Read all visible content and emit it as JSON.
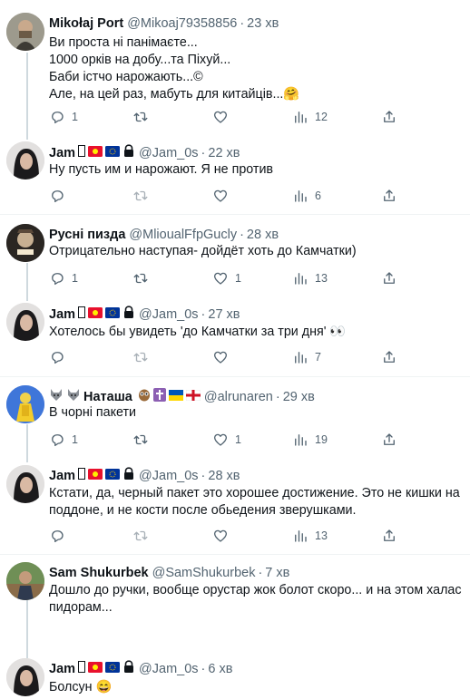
{
  "tweets": [
    {
      "name": "Mikołaj Port",
      "handle": "@Mikoaj79358856",
      "time": "23 хв",
      "lines": [
        "Ви проста ні панімаєте...",
        "1000 орків на добу...та Піхуй...",
        "Баби істчо нарожають...©",
        "Але, на цей раз, мабуть для китайців...🤗"
      ],
      "counts": {
        "reply": "1",
        "retweet": "",
        "like": "",
        "views": "12"
      }
    },
    {
      "name": "Jam",
      "handle": "@Jam_0s",
      "time": "22 хв",
      "lines": [
        "Ну пусть им и нарожают. Я не против"
      ],
      "counts": {
        "reply": "",
        "retweet": "",
        "like": "",
        "views": "6"
      }
    },
    {
      "name": "Русні пизда",
      "handle": "@MlioualFfpGucly",
      "time": "28 хв",
      "lines": [
        "Отрицательно наступая- дойдёт хоть до Камчатки)"
      ],
      "counts": {
        "reply": "1",
        "retweet": "",
        "like": "1",
        "views": "13"
      }
    },
    {
      "name": "Jam",
      "handle": "@Jam_0s",
      "time": "27 хв",
      "lines": [
        "Хотелось бы увидеть 'до Камчатки за три дня' 👀"
      ],
      "counts": {
        "reply": "",
        "retweet": "",
        "like": "",
        "views": "7"
      }
    },
    {
      "name": "Наташа",
      "handle": "@alrunaren",
      "time": "29 хв",
      "lines": [
        "В чорні пакети"
      ],
      "counts": {
        "reply": "1",
        "retweet": "",
        "like": "1",
        "views": "19"
      }
    },
    {
      "name": "Jam",
      "handle": "@Jam_0s",
      "time": "28 хв",
      "lines": [
        "Кстати, да, черный пакет это хорошее достижение. Это не кишки на",
        "поддоне, и не кости после обьедения зверушками."
      ],
      "counts": {
        "reply": "",
        "retweet": "",
        "like": "",
        "views": "13"
      }
    },
    {
      "name": "Sam Shukurbek",
      "handle": "@SamShukurbek",
      "time": "7 хв",
      "lines": [
        "Дошло до ручки, вообще орустар жок болот скоро... и на этом халас",
        "пидорам..."
      ],
      "counts": {
        "reply": "",
        "retweet": "",
        "like": "",
        "views": ""
      }
    },
    {
      "name": "Jam",
      "handle": "@Jam_0s",
      "time": "6 хв",
      "lines": [
        "Болсун 😄"
      ],
      "counts": {
        "reply": "",
        "retweet": "",
        "like": "",
        "views": ""
      }
    }
  ],
  "dot": "·",
  "colors": {
    "text": "#0f1419",
    "muted": "#536471",
    "separator": "#eff3f4",
    "thread_line": "#cfd9de",
    "kg_red": "#e8112d",
    "eu_blue": "#003399"
  },
  "icons": {
    "reply": "reply-icon",
    "retweet": "retweet-icon",
    "like": "like-icon",
    "views": "views-icon",
    "share": "share-icon",
    "lock": "lock-icon"
  }
}
